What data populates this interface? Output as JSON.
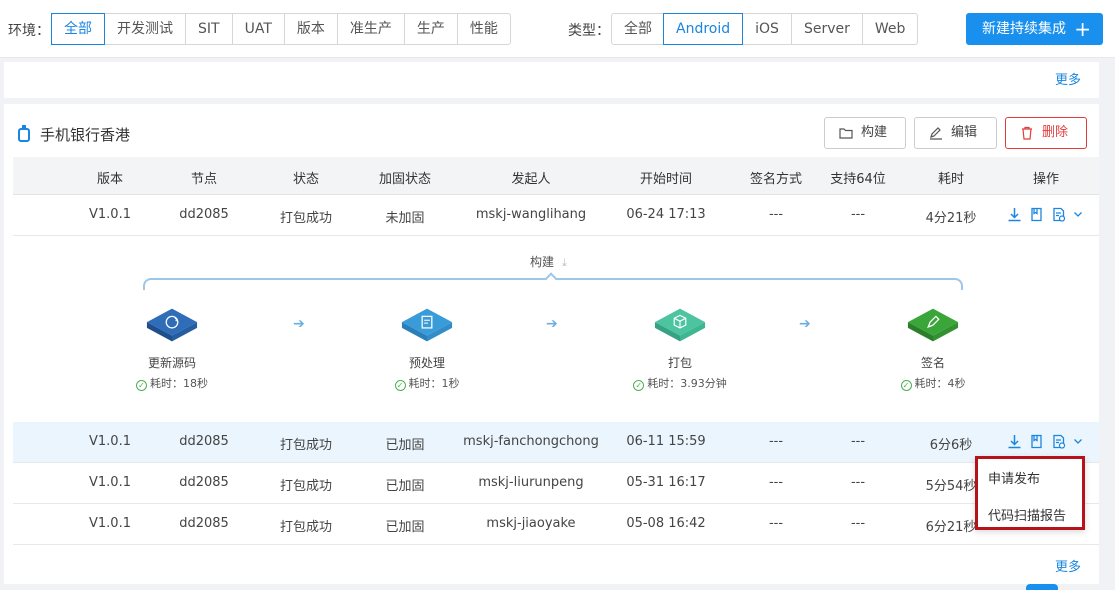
{
  "filters": {
    "env_label": "环境：",
    "env_options": [
      "全部",
      "开发测试",
      "SIT",
      "UAT",
      "版本",
      "准生产",
      "生产",
      "性能"
    ],
    "env_active": "全部",
    "type_label": "类型：",
    "type_options": [
      "全部",
      "Android",
      "iOS",
      "Server",
      "Web"
    ],
    "type_active": "Android"
  },
  "new_button": {
    "label": "新建持续集成",
    "icon": "plus-icon"
  },
  "more_label": "更多",
  "card": {
    "title": "手机银行香港",
    "title_icon": "android-icon",
    "actions": {
      "build": "构建",
      "edit": "编辑",
      "delete": "删除"
    }
  },
  "table": {
    "headers": [
      "版本",
      "节点",
      "状态",
      "加固状态",
      "发起人",
      "开始时间",
      "签名方式",
      "支持64位",
      "耗时",
      "操作"
    ],
    "rows": [
      {
        "version": "V1.0.1",
        "node": "dd2085",
        "status": "打包成功",
        "harden": "未加固",
        "initiator": "mskj-wanglihang",
        "start": "06-24 17:13",
        "sign": "---",
        "x64": "---",
        "duration": "4分21秒"
      },
      {
        "version": "V1.0.1",
        "node": "dd2085",
        "status": "打包成功",
        "harden": "已加固",
        "initiator": "mskj-fanchongchong",
        "start": "06-11 15:59",
        "sign": "---",
        "x64": "---",
        "duration": "6分6秒"
      },
      {
        "version": "V1.0.1",
        "node": "dd2085",
        "status": "打包成功",
        "harden": "已加固",
        "initiator": "mskj-liurunpeng",
        "start": "05-31 16:17",
        "sign": "---",
        "x64": "---",
        "duration": "5分54秒"
      },
      {
        "version": "V1.0.1",
        "node": "dd2085",
        "status": "打包成功",
        "harden": "已加固",
        "initiator": "mskj-jiaoyake",
        "start": "05-08 16:42",
        "sign": "---",
        "x64": "---",
        "duration": "6分21秒"
      }
    ]
  },
  "pipeline": {
    "title": "构建",
    "stages": [
      {
        "name": "更新源码",
        "duration": "耗时：18秒",
        "color": "#2f6db8",
        "icon": "refresh-icon"
      },
      {
        "name": "预处理",
        "duration": "耗时：1秒",
        "color": "#3a9bd9",
        "icon": "document-icon"
      },
      {
        "name": "打包",
        "duration": "耗时：3.93分钟",
        "color": "#4cc4a0",
        "icon": "package-icon"
      },
      {
        "name": "签名",
        "duration": "耗时：4秒",
        "color": "#3aa63a",
        "icon": "pen-icon"
      }
    ]
  },
  "dropdown": {
    "items": [
      "申请发布",
      "代码扫描报告"
    ]
  },
  "colors": {
    "accent": "#1a86e0",
    "danger": "#e23b3b",
    "highlight_border": "#b5121b"
  }
}
